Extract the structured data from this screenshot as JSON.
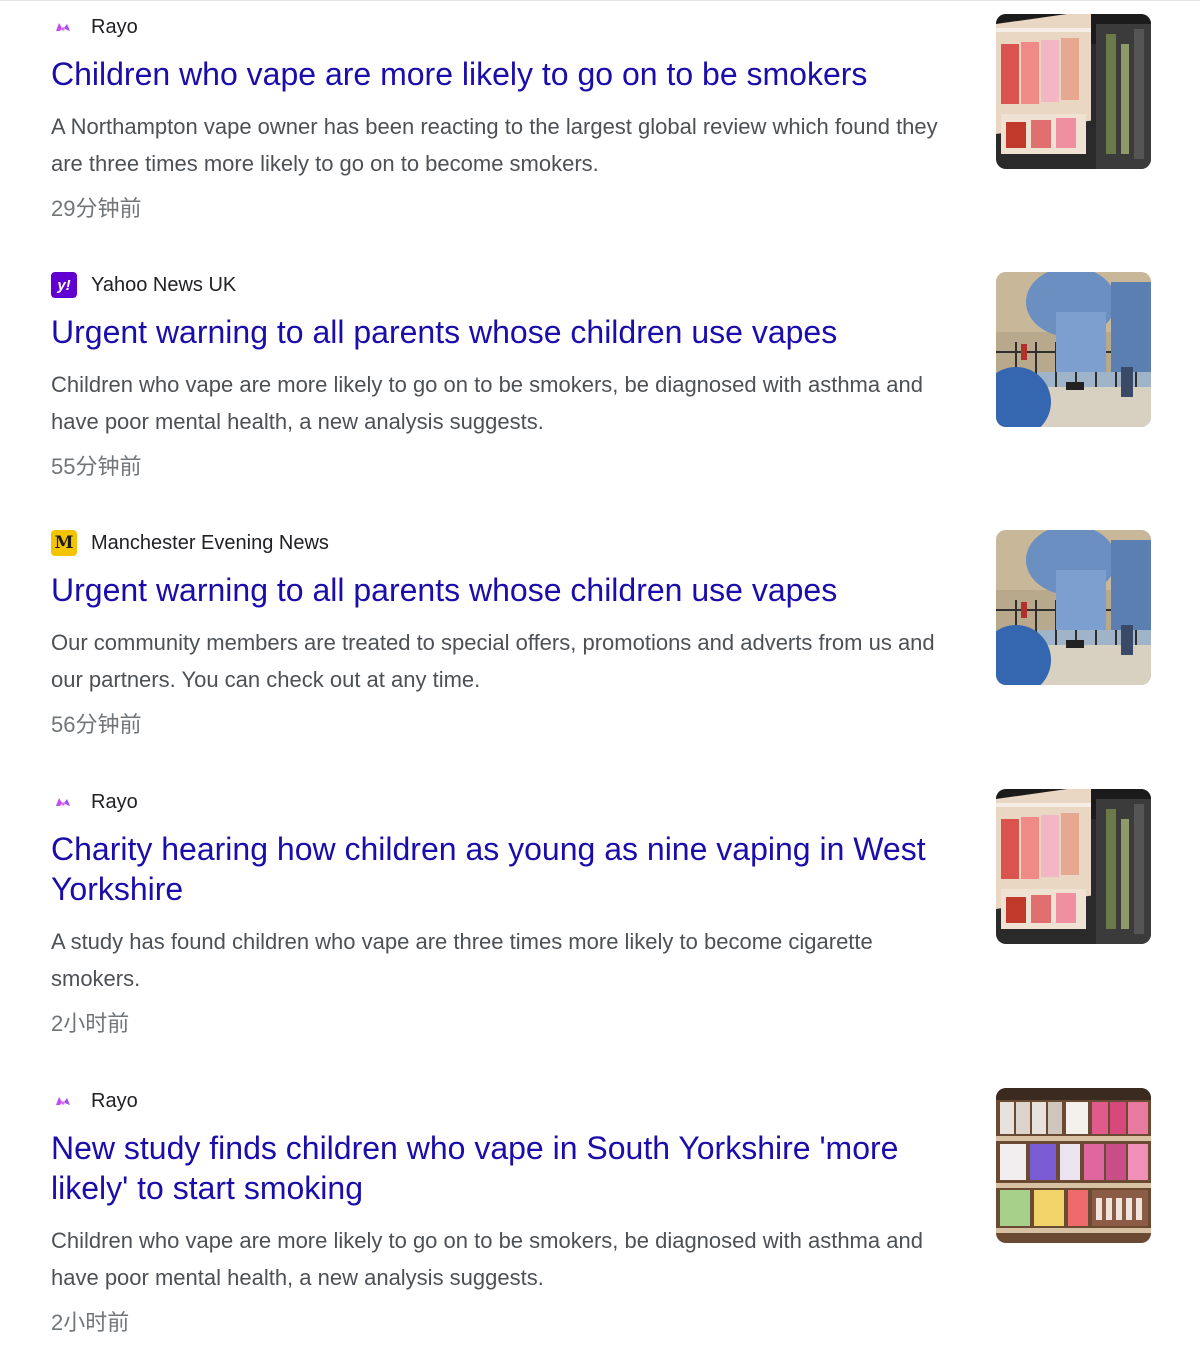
{
  "colors": {
    "headline": "#1a0dab",
    "snippet": "#4d5156",
    "timestamp": "#70757a",
    "yahoo_brand": "#6001d2",
    "men_brand": "#f5c400",
    "rayo_brand": "#c64cf0"
  },
  "articles": [
    {
      "source": "Rayo",
      "source_icon": "rayo-logo-icon",
      "headline": "Children who vape are more likely to go on to be smokers",
      "snippet": "A Northampton vape owner has been reacting to the largest global review which found they are three times more likely to go on to become smokers.",
      "time": "29分钟前",
      "thumbnail": "vape-shop-shelf-image"
    },
    {
      "source": "Yahoo News UK",
      "source_icon": "yahoo-logo-icon",
      "source_icon_text": "y!",
      "headline": "Urgent warning to all parents whose children use vapes",
      "snippet": "Children who vape are more likely to go on to be smokers, be diagnosed with asthma and have poor mental health, a new analysis suggests.",
      "time": "55分钟前",
      "thumbnail": "teenagers-vaping-image"
    },
    {
      "source": "Manchester Evening News",
      "source_icon": "men-logo-icon",
      "source_icon_text": "M",
      "headline": "Urgent warning to all parents whose children use vapes",
      "snippet": "Our community members are treated to special offers, promotions and adverts from us and our partners. You can check out at any time.",
      "time": "56分钟前",
      "thumbnail": "teenagers-vaping-image"
    },
    {
      "source": "Rayo",
      "source_icon": "rayo-logo-icon",
      "headline": "Charity hearing how children as young as nine vaping in West Yorkshire",
      "snippet": "A study has found children who vape are three times more likely to become cigarette smokers.",
      "time": "2小时前",
      "thumbnail": "vape-shop-shelf-image"
    },
    {
      "source": "Rayo",
      "source_icon": "rayo-logo-icon",
      "headline": "New study finds children who vape in South Yorkshire 'more likely' to start smoking",
      "snippet": "Children who vape are more likely to go on to be smokers, be diagnosed with asthma and have poor mental health, a new analysis suggests.",
      "time": "2小时前",
      "thumbnail": "vape-display-shelves-image"
    }
  ]
}
